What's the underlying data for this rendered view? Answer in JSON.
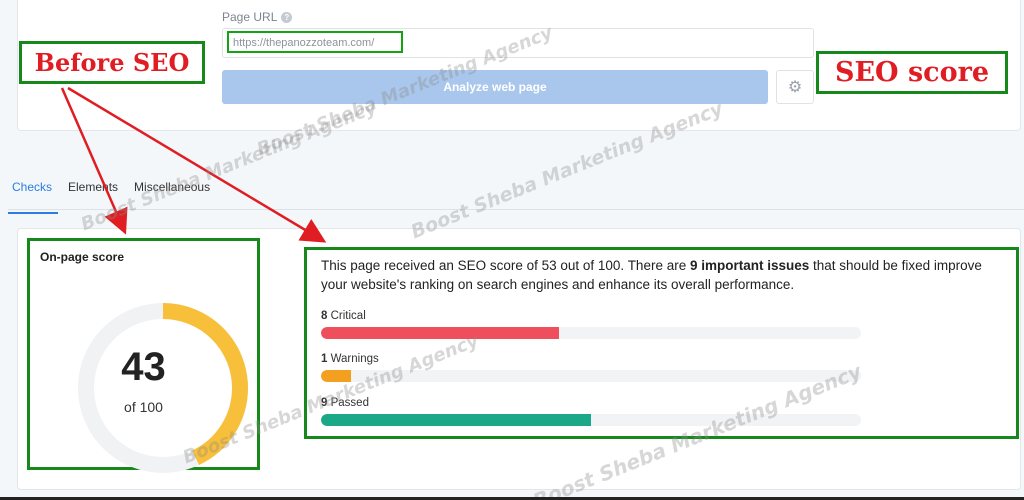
{
  "form": {
    "url_label": "Page URL",
    "url_help": "?",
    "url_value": "https://thepanozzoteam.com/",
    "analyze_label": "Analyze web page",
    "settings_icon": "gear-icon"
  },
  "callouts": {
    "before": "Before SEO",
    "score": "SEO score"
  },
  "tabs": [
    {
      "label": "Checks",
      "active": true
    },
    {
      "label": "Elements",
      "active": false
    },
    {
      "label": "Miscellaneous",
      "active": false
    }
  ],
  "score": {
    "title": "On-page score",
    "value": "43",
    "of": "of 100",
    "fraction": 0.43,
    "color": "#f7bf3a"
  },
  "summary": {
    "pre": "This page received an SEO score of 53 out of 100. There are ",
    "bold": "9 important issues",
    "post": " that should be fixed improve your website's ranking on search engines and enhance its overall performance."
  },
  "metrics": [
    {
      "count": "8",
      "label": "Critical",
      "fraction": 0.44,
      "color": "#ef4f5d"
    },
    {
      "count": "1",
      "label": "Warnings",
      "fraction": 0.055,
      "color": "#f3a020"
    },
    {
      "count": "9",
      "label": "Passed",
      "fraction": 0.5,
      "color": "#1aa889"
    }
  ],
  "watermark": "Boost Sheba Marketing Agency"
}
